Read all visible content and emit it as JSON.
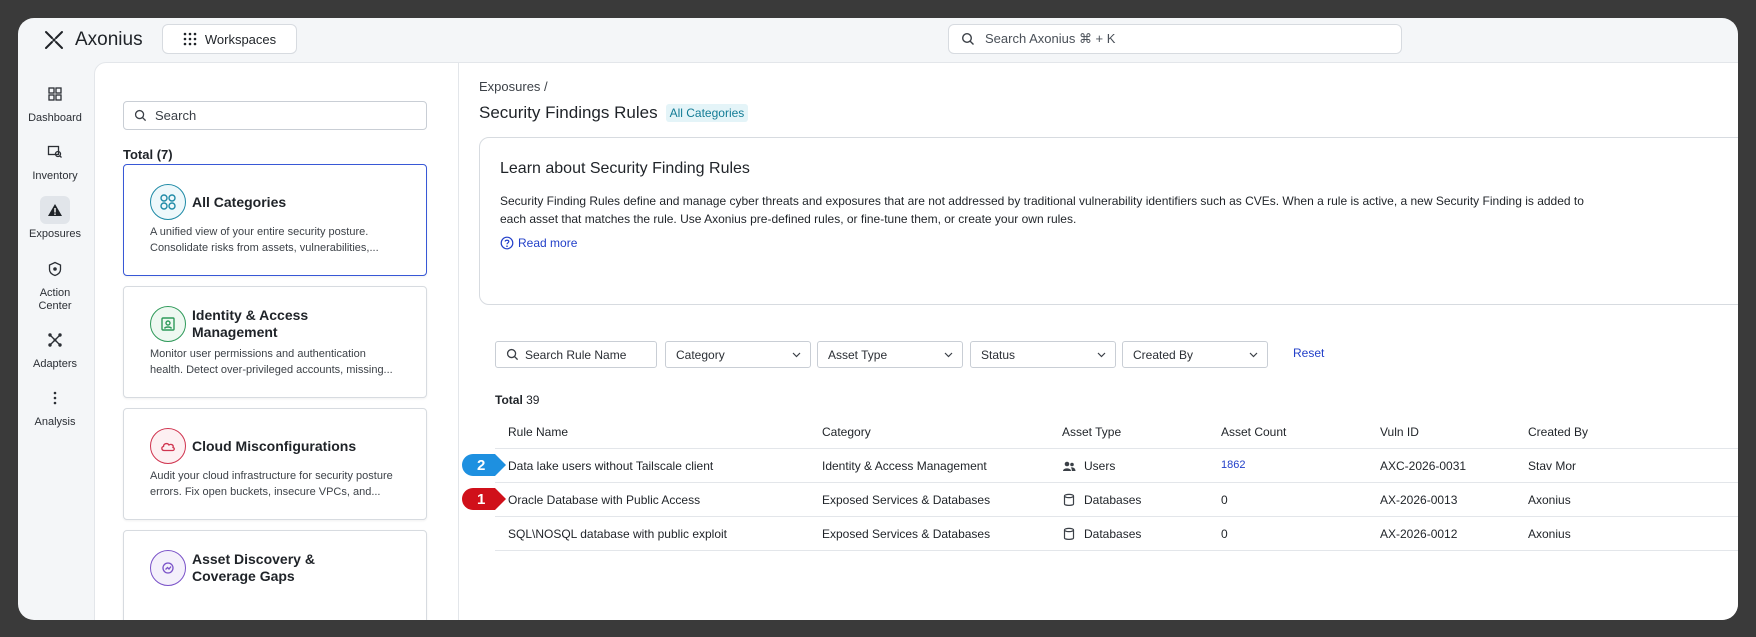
{
  "app": {
    "name": "Axonius"
  },
  "topbar": {
    "workspaces_label": "Workspaces",
    "search_placeholder": "Search Axonius ⌘ + K"
  },
  "nav": {
    "items": [
      {
        "label": "Dashboard",
        "icon": "dashboard-icon"
      },
      {
        "label": "Inventory",
        "icon": "inventory-icon"
      },
      {
        "label": "Exposures",
        "icon": "warning-icon",
        "active": true
      },
      {
        "label": "Action Center",
        "icon": "shield-icon"
      },
      {
        "label": "Adapters",
        "icon": "adapters-icon"
      },
      {
        "label": "Analysis",
        "icon": "more-vertical-icon"
      }
    ]
  },
  "categories": {
    "search_placeholder": "Search",
    "total_label": "Total (7)",
    "items": [
      {
        "title": "All Categories",
        "description": "A unified view of your entire security posture. Consolidate risks from assets, vulnerabilities,...",
        "icon": "grid-circles-icon",
        "color": "#1e8aa6",
        "selected": true
      },
      {
        "title": "Identity & Access Management",
        "description": "Monitor user permissions and authentication health. Detect over-privileged accounts, missing...",
        "icon": "id-badge-icon",
        "color": "#2f9a5a"
      },
      {
        "title": "Cloud Misconfigurations",
        "description": "Audit your cloud infrastructure for security posture errors. Fix open buckets, insecure VPCs, and...",
        "icon": "cloud-icon",
        "color": "#d0344f"
      },
      {
        "title": "Asset Discovery & Coverage Gaps",
        "description": "",
        "icon": "discovery-icon",
        "color": "#7a52c8"
      }
    ]
  },
  "main": {
    "breadcrumb": "Exposures /",
    "title": "Security Findings Rules",
    "title_badge": "All Categories",
    "info": {
      "heading": "Learn about Security Finding Rules",
      "text": "Security Finding Rules define and manage cyber threats and exposures that are not addressed by traditional vulnerability identifiers such as CVEs. When a rule is active, a new Security Finding is added to each asset that matches the rule. Use Axonius pre-defined rules, or fine-tune them, or create your own rules.",
      "read_more": "Read more"
    },
    "filters": {
      "search_placeholder": "Search Rule Name",
      "category": "Category",
      "asset_type": "Asset Type",
      "status": "Status",
      "created_by": "Created By",
      "reset": "Reset"
    },
    "total_label": "Total",
    "total_value": "39",
    "table": {
      "columns": [
        "Rule Name",
        "Category",
        "Asset Type",
        "Asset Count",
        "Vuln ID",
        "Created By"
      ],
      "rows": [
        {
          "rule": "Data lake users without Tailscale client",
          "category": "Identity & Access Management",
          "asset_type": "Users",
          "asset_icon": "users-icon",
          "count": "1862",
          "vuln_id": "AXC-2026-0031",
          "created_by": "Stav Mor",
          "callout": "2",
          "callout_color": "#1e90e0"
        },
        {
          "rule": "Oracle Database with Public Access",
          "category": "Exposed Services & Databases",
          "asset_type": "Databases",
          "asset_icon": "database-icon",
          "count": "0",
          "vuln_id": "AX-2026-0013",
          "created_by": "Axonius",
          "callout": "1",
          "callout_color": "#d0101a"
        },
        {
          "rule": "SQL\\NOSQL database with public exploit",
          "category": "Exposed Services & Databases",
          "asset_type": "Databases",
          "asset_icon": "database-icon",
          "count": "0",
          "vuln_id": "AX-2026-0012",
          "created_by": "Axonius"
        }
      ]
    }
  }
}
